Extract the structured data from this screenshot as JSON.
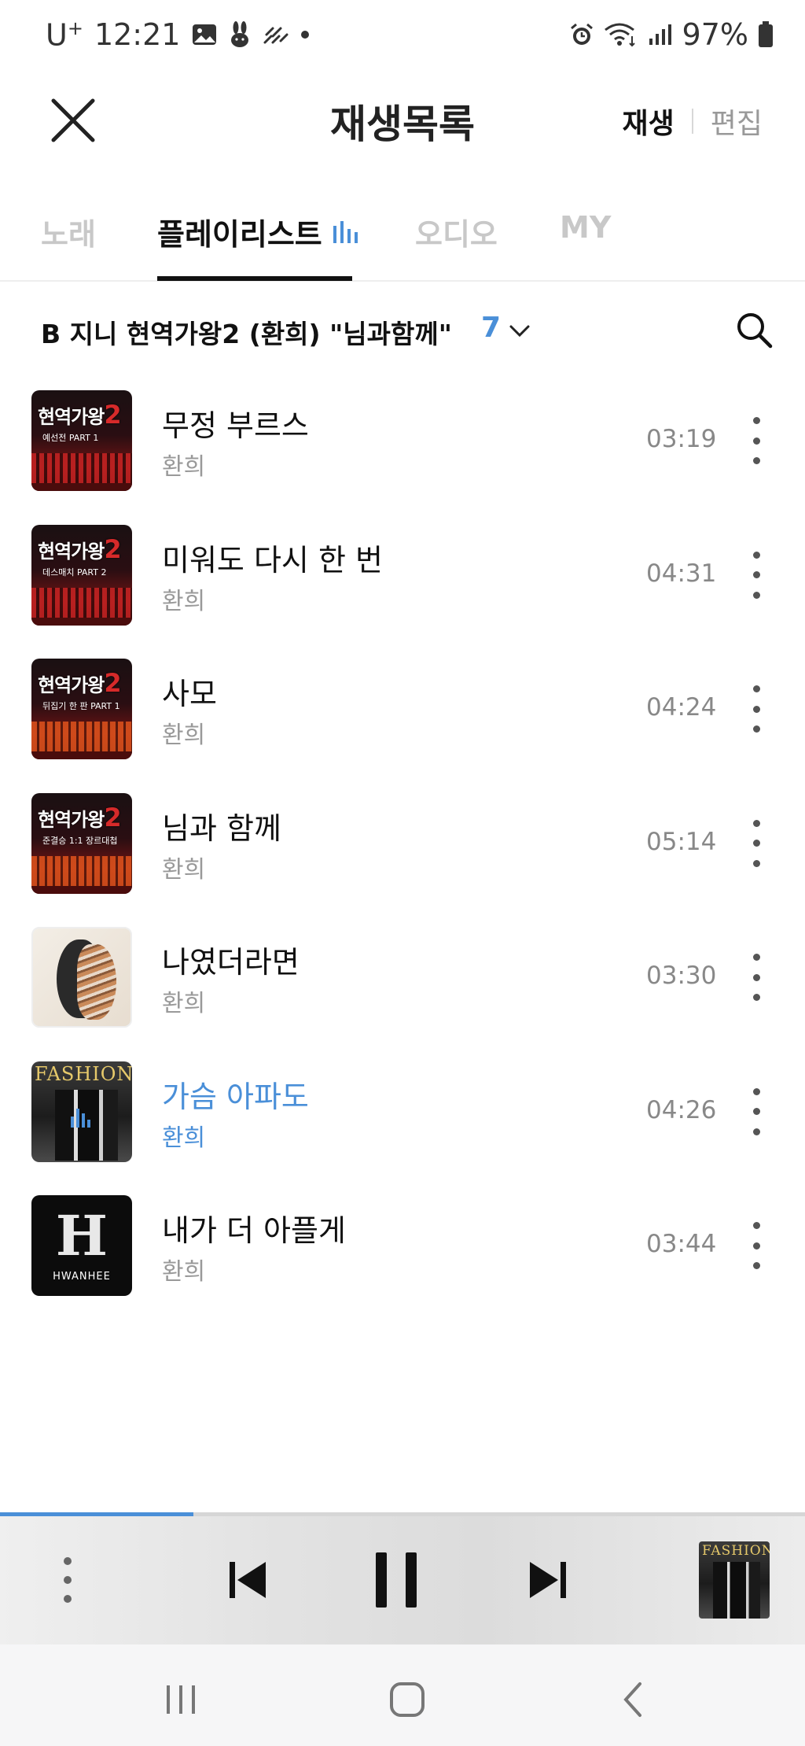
{
  "status_bar": {
    "carrier": "U",
    "carrier_sup": "+",
    "time": "12:21",
    "battery": "97%"
  },
  "header": {
    "title": "재생목록",
    "play_label": "재생",
    "edit_label": "편집"
  },
  "tabs": [
    {
      "label": "노래",
      "active": false
    },
    {
      "label": "플레이리스트",
      "active": true
    },
    {
      "label": "오디오",
      "active": false
    },
    {
      "label": "MY",
      "active": false
    }
  ],
  "playlist": {
    "title": "B 지니 현역가왕2 (환희) \"님과함께\"...",
    "count": "7"
  },
  "songs": [
    {
      "title": "무정 부르스",
      "artist": "환희",
      "duration": "03:19",
      "art_sub": "예선전 PART 1"
    },
    {
      "title": "미워도 다시 한 번",
      "artist": "환희",
      "duration": "04:31",
      "art_sub": "데스매치 PART 2"
    },
    {
      "title": "사모",
      "artist": "환희",
      "duration": "04:24",
      "art_sub": "뒤집기 한 판 PART 1"
    },
    {
      "title": "님과 함께",
      "artist": "환희",
      "duration": "05:14",
      "art_sub": "준결승 1:1 장르대첩"
    },
    {
      "title": "나였더라면",
      "artist": "환희",
      "duration": "03:30"
    },
    {
      "title": "가슴 아파도",
      "artist": "환희",
      "duration": "04:26",
      "playing": true,
      "art_title": "FASHION"
    },
    {
      "title": "내가 더 아플게",
      "artist": "환희",
      "duration": "03:44",
      "art_name": "HWANHEE"
    }
  ],
  "art_logo": {
    "main": "현역가왕",
    "num": "2"
  },
  "player": {
    "progress": 0.24,
    "art_title": "FASHION"
  },
  "colors": {
    "accent": "#4a8fd8",
    "text": "#111111",
    "muted": "#999999"
  },
  "icons": {
    "close": "close-icon",
    "search": "search-icon",
    "chevron": "chevron-down-icon",
    "more": "more-vertical-icon",
    "prev": "skip-previous-icon",
    "pause": "pause-icon",
    "next": "skip-next-icon"
  }
}
